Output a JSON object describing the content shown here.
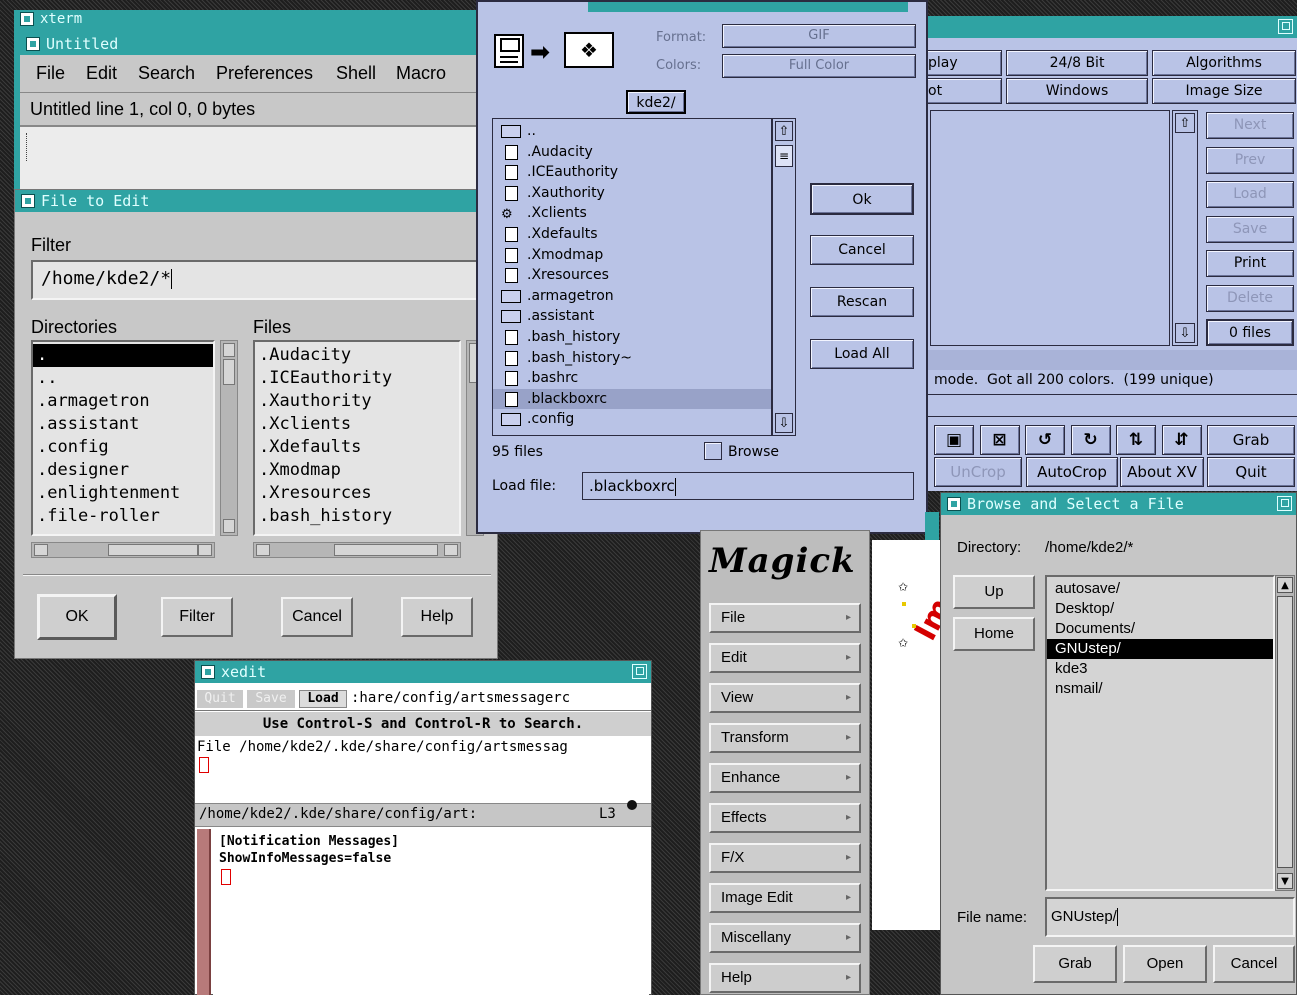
{
  "xterm": {
    "title": "xterm"
  },
  "nedit": {
    "title": "Untitled",
    "menu": [
      "File",
      "Edit",
      "Search",
      "Preferences",
      "Shell",
      "Macro"
    ],
    "status": "Untitled line 1, col 0, 0 bytes"
  },
  "file_dialog": {
    "title": "File to Edit",
    "filter_label": "Filter",
    "filter_value": "/home/kde2/*",
    "dirs_label": "Directories",
    "files_label": "Files",
    "directories": [
      ".",
      "..",
      ".armagetron",
      ".assistant",
      ".config",
      ".designer",
      ".enlightenment",
      ".file-roller"
    ],
    "files": [
      ".Audacity",
      ".ICEauthority",
      ".Xauthority",
      ".Xclients",
      ".Xdefaults",
      ".Xmodmap",
      ".Xresources",
      ".bash_history"
    ],
    "buttons": {
      "ok": "OK",
      "filter": "Filter",
      "cancel": "Cancel",
      "help": "Help"
    }
  },
  "xv_load": {
    "format_label": "Format:",
    "format_value": "GIF",
    "colors_label": "Colors:",
    "colors_value": "Full Color",
    "dir": "kde2/",
    "files": [
      {
        "name": "..",
        "type": "folder"
      },
      {
        "name": ".Audacity",
        "type": "file"
      },
      {
        "name": ".ICEauthority",
        "type": "file"
      },
      {
        "name": ".Xauthority",
        "type": "file"
      },
      {
        "name": ".Xclients",
        "type": "exec"
      },
      {
        "name": ".Xdefaults",
        "type": "file"
      },
      {
        "name": ".Xmodmap",
        "type": "file"
      },
      {
        "name": ".Xresources",
        "type": "file"
      },
      {
        "name": ".armagetron",
        "type": "folder"
      },
      {
        "name": ".assistant",
        "type": "folder"
      },
      {
        "name": ".bash_history",
        "type": "file"
      },
      {
        "name": ".bash_history~",
        "type": "file"
      },
      {
        "name": ".bashrc",
        "type": "file"
      },
      {
        "name": ".blackboxrc",
        "type": "file",
        "selected": true
      },
      {
        "name": ".config",
        "type": "folder"
      }
    ],
    "buttons": {
      "ok": "Ok",
      "cancel": "Cancel",
      "rescan": "Rescan",
      "load_all": "Load All"
    },
    "count": "95 files",
    "browse": "Browse",
    "load_label": "Load file:",
    "load_value": ".blackboxrc"
  },
  "xv_controls": {
    "top_buttons": [
      "play",
      "24/8 Bit",
      "Algorithms",
      "ot",
      "Windows",
      "Image Size"
    ],
    "side_buttons": [
      {
        "label": "Next",
        "disabled": true
      },
      {
        "label": "Prev",
        "disabled": true
      },
      {
        "label": "Load",
        "disabled": true
      },
      {
        "label": "Save",
        "disabled": true
      },
      {
        "label": "Print",
        "disabled": false
      },
      {
        "label": "Delete",
        "disabled": true
      },
      {
        "label": "0 files",
        "disabled": false
      }
    ],
    "status": "mode.  Got all 200 colors.  (199 unique)",
    "tool_glyphs": [
      "▣",
      "⊠",
      "↺",
      "↻",
      "⇅",
      "⇵"
    ],
    "grab": "Grab",
    "bottom_buttons": [
      "UnCrop",
      "AutoCrop",
      "About XV",
      "Quit"
    ]
  },
  "xedit": {
    "title": "xedit",
    "buttons": {
      "quit": "Quit",
      "save": "Save",
      "load": "Load"
    },
    "filename_field": ":hare/config/artsmessagerc",
    "message": "Use Control-S and Control-R to Search.",
    "file_line": "File /home/kde2/.kde/share/config/artsmessag",
    "mode_path": "/home/kde2/.kde/share/config/art:",
    "mode_line": "L3",
    "content": [
      "[Notification Messages]",
      "ShowInfoMessages=false"
    ]
  },
  "magick": {
    "logo": "Magick",
    "menu": [
      "File",
      "Edit",
      "View",
      "Transform",
      "Enhance",
      "Effects",
      "F/X",
      "Image Edit",
      "Miscellany",
      "Help"
    ],
    "canvas_text": "Im"
  },
  "gnustep": {
    "title": "Browse and Select a File",
    "directory_label": "Directory:",
    "directory_value": "/home/kde2/*",
    "up": "Up",
    "home": "Home",
    "entries": [
      "autosave/",
      "Desktop/",
      "Documents/",
      "GNUstep/",
      "kde3",
      "nsmail/"
    ],
    "selected_index": 3,
    "filename_label": "File name:",
    "filename_value": "GNUstep/",
    "buttons": {
      "grab": "Grab",
      "open": "Open",
      "cancel": "Cancel"
    }
  },
  "colors": {
    "title_bar": "#2fa3a3",
    "xv_panel": "#b9c3e6",
    "motif_panel": "#c8c8c8",
    "text_cursor": "#e00000"
  }
}
